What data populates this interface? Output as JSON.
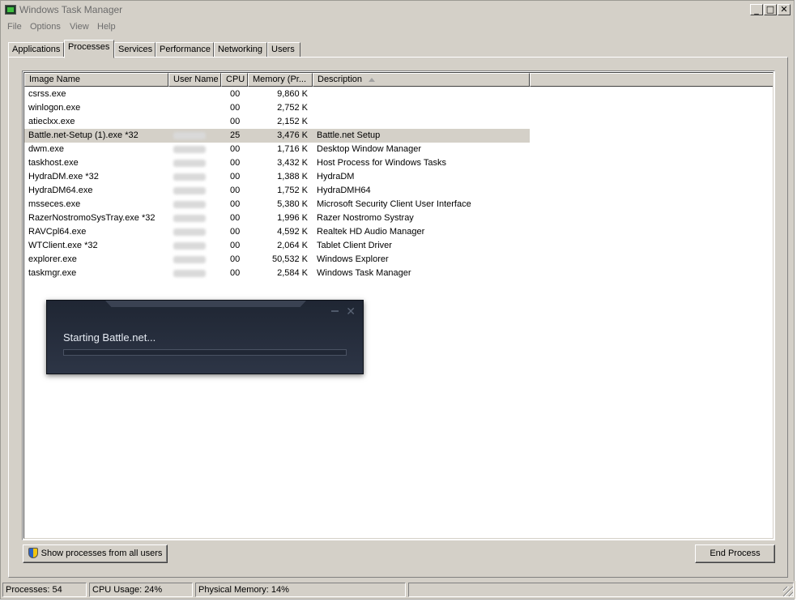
{
  "window": {
    "title": "Windows Task Manager",
    "controls": {
      "minimize": "_",
      "maximize": "□",
      "close": "✕"
    }
  },
  "menu": [
    "File",
    "Options",
    "View",
    "Help"
  ],
  "tabs": [
    "Applications",
    "Processes",
    "Services",
    "Performance",
    "Networking",
    "Users"
  ],
  "active_tab": "Processes",
  "table": {
    "columns": [
      "Image Name",
      "User Name",
      "CPU",
      "Memory (Pr...",
      "Description"
    ],
    "sorted_column": "Description",
    "rows": [
      {
        "image": "csrss.exe",
        "user": "",
        "cpu": "00",
        "memory": "9,860 K",
        "description": ""
      },
      {
        "image": "winlogon.exe",
        "user": "",
        "cpu": "00",
        "memory": "2,752 K",
        "description": ""
      },
      {
        "image": "atieclxx.exe",
        "user": "",
        "cpu": "00",
        "memory": "2,152 K",
        "description": ""
      },
      {
        "image": "Battle.net-Setup (1).exe *32",
        "user": "blurred",
        "cpu": "25",
        "memory": "3,476 K",
        "description": "Battle.net Setup"
      },
      {
        "image": "dwm.exe",
        "user": "blurred",
        "cpu": "00",
        "memory": "1,716 K",
        "description": "Desktop Window Manager"
      },
      {
        "image": "taskhost.exe",
        "user": "blurred",
        "cpu": "00",
        "memory": "3,432 K",
        "description": "Host Process for Windows Tasks"
      },
      {
        "image": "HydraDM.exe *32",
        "user": "blurred",
        "cpu": "00",
        "memory": "1,388 K",
        "description": "HydraDM"
      },
      {
        "image": "HydraDM64.exe",
        "user": "blurred",
        "cpu": "00",
        "memory": "1,752 K",
        "description": "HydraDMH64"
      },
      {
        "image": "msseces.exe",
        "user": "blurred",
        "cpu": "00",
        "memory": "5,380 K",
        "description": "Microsoft Security Client User Interface"
      },
      {
        "image": "RazerNostromoSysTray.exe *32",
        "user": "blurred",
        "cpu": "00",
        "memory": "1,996 K",
        "description": "Razer Nostromo Systray"
      },
      {
        "image": "RAVCpl64.exe",
        "user": "blurred",
        "cpu": "00",
        "memory": "4,592 K",
        "description": "Realtek HD Audio Manager"
      },
      {
        "image": "WTClient.exe *32",
        "user": "blurred",
        "cpu": "00",
        "memory": "2,064 K",
        "description": "Tablet Client Driver"
      },
      {
        "image": "explorer.exe",
        "user": "blurred",
        "cpu": "00",
        "memory": "50,532 K",
        "description": "Windows Explorer"
      },
      {
        "image": "taskmgr.exe",
        "user": "blurred",
        "cpu": "00",
        "memory": "2,584 K",
        "description": "Windows Task Manager"
      }
    ],
    "selected_row_index": 3
  },
  "buttons": {
    "show_all": "Show processes from all users",
    "end_process": "End Process"
  },
  "status": {
    "processes": "Processes: 54",
    "cpu": "CPU Usage: 24%",
    "memory": "Physical Memory: 14%"
  },
  "battlenet": {
    "message": "Starting Battle.net...",
    "progress": 0.0,
    "close": "✕"
  },
  "colors": {
    "chrome": "#d4d0c8",
    "dialog_bg": "#2d3546",
    "dialog_text": "#e7ecf4"
  }
}
